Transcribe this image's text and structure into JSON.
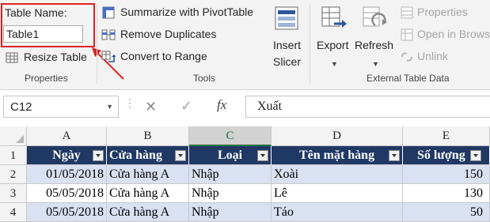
{
  "ribbon": {
    "properties": {
      "table_name_label": "Table Name:",
      "table_name_value": "Table1",
      "resize_label": "Resize Table",
      "group_label": "Properties"
    },
    "tools": {
      "summarize_label": "Summarize with PivotTable",
      "remove_dup_label": "Remove Duplicates",
      "convert_label": "Convert to Range",
      "insert_slicer_line1": "Insert",
      "insert_slicer_line2": "Slicer",
      "group_label": "Tools"
    },
    "external": {
      "export_label": "Export",
      "refresh_label": "Refresh",
      "properties_label": "Properties",
      "open_browser_label": "Open in Brows",
      "unlink_label": "Unlink",
      "group_label": "External Table Data"
    },
    "accent_red": "#e02020"
  },
  "formula_bar": {
    "name_box": "C12",
    "fx": "fx",
    "value": "Xuất"
  },
  "sheet": {
    "columns": [
      "A",
      "B",
      "C",
      "D",
      "E"
    ],
    "rows": [
      "1",
      "2",
      "3",
      "4"
    ],
    "header": [
      "Ngày",
      "Cửa hàng",
      "Loại",
      "Tên mặt hàng",
      "Số lượng"
    ],
    "data": [
      [
        "01/05/2018",
        "Cửa hàng A",
        "Nhập",
        "Xoài",
        "150"
      ],
      [
        "05/05/2018",
        "Cửa hàng A",
        "Nhập",
        "Lê",
        "130"
      ],
      [
        "05/05/2018",
        "Cửa hàng A",
        "Nhập",
        "Táo",
        "50"
      ]
    ],
    "header_color": "#1f3864",
    "band_color": "#d9e1f2"
  }
}
